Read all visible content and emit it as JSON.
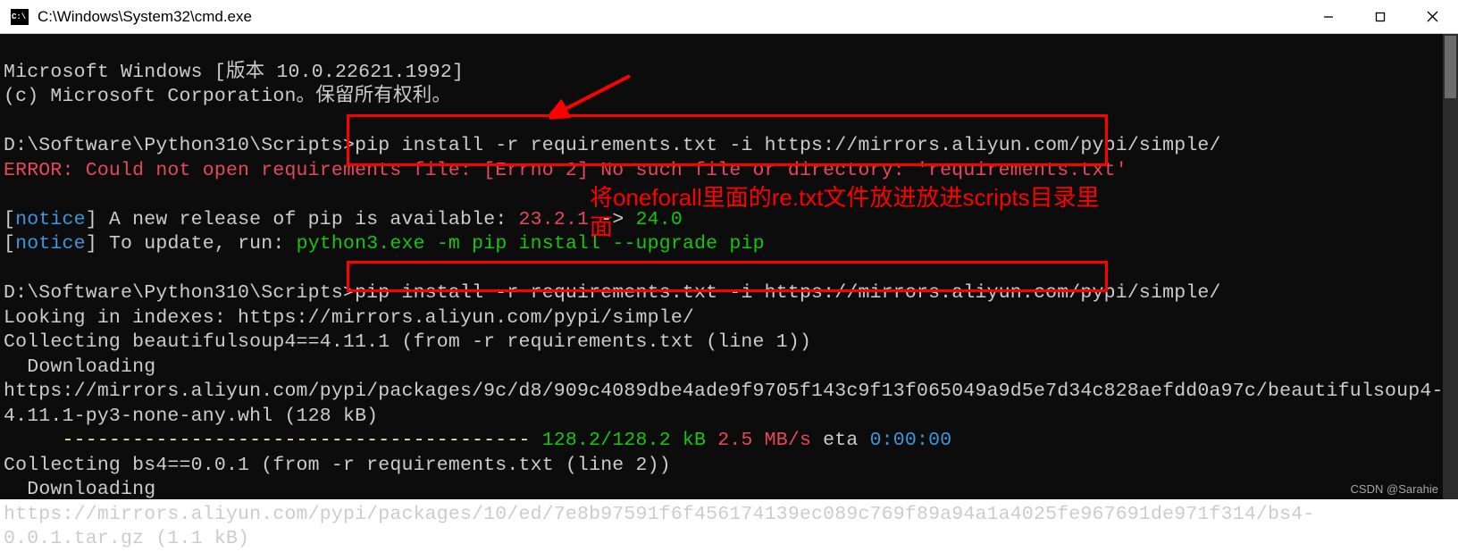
{
  "titlebar": {
    "title": "C:\\Windows\\System32\\cmd.exe"
  },
  "term": {
    "banner1": "Microsoft Windows [版本 10.0.22621.1992]",
    "banner2": "(c) Microsoft Corporation。保留所有权利。",
    "prompt1_path": "D:\\Software\\Python310\\Scripts>",
    "cmd1": "pip install -r requirements.txt -i https://mirrors.aliyun.com/pypi/simple/",
    "error": "ERROR: Could not open requirements file: [Errno 2] No such file or directory: 'requirements.txt'",
    "notice_open": "[",
    "notice_word": "notice",
    "notice_close": "]",
    "notice1_rest": " A new release of pip is available: ",
    "notice1_ver1": "23.2.1",
    "notice1_arrow": " -> ",
    "notice1_ver2": "24.0",
    "notice2_rest": " To update, run: ",
    "notice2_cmd": "python3.exe -m pip install --upgrade pip",
    "prompt2_path": "D:\\Software\\Python310\\Scripts>",
    "cmd2": "pip install -r requirements.txt -i https://mirrors.aliyun.com/pypi/simple/",
    "looking": "Looking in indexes: https://mirrors.aliyun.com/pypi/simple/",
    "collect1": "Collecting beautifulsoup4==4.11.1 (from -r requirements.txt (line 1))",
    "download1": "  Downloading https://mirrors.aliyun.com/pypi/packages/9c/d8/909c4089dbe4ade9f9705f143c9f13f065049a9d5e7d34c828aefdd0a97c/beautifulsoup4-4.11.1-py3-none-any.whl (128 kB)",
    "progress_dashes": "     ---------------------------------------- ",
    "progress_size": "128.2/128.2 kB",
    "progress_speed": " 2.5 MB/s",
    "progress_eta_label": " eta ",
    "progress_eta": "0:00:00",
    "collect2": "Collecting bs4==0.0.1 (from -r requirements.txt (line 2))",
    "download2": "  Downloading https://mirrors.aliyun.com/pypi/packages/10/ed/7e8b97591f6f456174139ec089c769f89a94a1a4025fe967691de971f314/bs4-0.0.1.tar.gz (1.1 kB)"
  },
  "annotations": {
    "text1": "将oneforall里面的re.txt文件放进放进scripts目录里",
    "text2": "面"
  },
  "watermark": "CSDN @Sarahie"
}
